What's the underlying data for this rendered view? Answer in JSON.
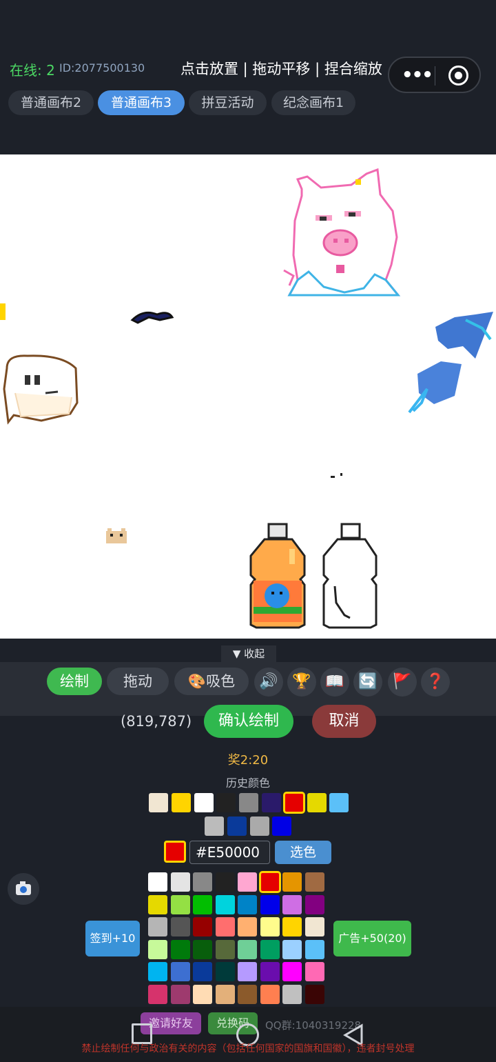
{
  "header": {
    "online": "在线: 2",
    "user_id": "ID:2077500130",
    "hint": "点击放置 | 拖动平移 | 捏合缩放"
  },
  "tabs": [
    {
      "label": "普通画布2",
      "active": false
    },
    {
      "label": "普通画布3",
      "active": true
    },
    {
      "label": "拼豆活动",
      "active": false
    },
    {
      "label": "纪念画布1",
      "active": false
    }
  ],
  "toolbar": {
    "collapse": "▼ 收起",
    "draw": "绘制",
    "drag": "拖动",
    "pick": "吸色",
    "icons": [
      "speaker-icon",
      "trophy-icon",
      "book-icon",
      "refresh-icon",
      "flag-icon",
      "help-icon"
    ]
  },
  "actions": {
    "coord": "(819,787)",
    "confirm": "确认绘制",
    "cancel": "取消"
  },
  "reward": "奖2:20",
  "history": {
    "label": "历史颜色",
    "colors": [
      "#f1e6d2",
      "#ffd400",
      "#ffffff",
      "#222222",
      "#888888",
      "#2a1a6a",
      "#e50000",
      "#e5d900",
      "#5bc0f8",
      "#bbbbbb",
      "#0a3a9a",
      "#aaaaaa",
      "#0000e5"
    ],
    "selected_index": 6
  },
  "current": {
    "color": "#e50000",
    "hex": "#E50000",
    "pick_button": "选色"
  },
  "palette": {
    "colors": [
      "#ffffff",
      "#e4e4e4",
      "#888888",
      "#222222",
      "#ffa7d1",
      "#e50000",
      "#e59500",
      "#a06a42",
      "#e5d900",
      "#94e044",
      "#02be01",
      "#00d3dd",
      "#0083c7",
      "#0000ea",
      "#cf6ee4",
      "#820080",
      "#b5b5b5",
      "#555555",
      "#960000",
      "#ff6e6e",
      "#ffb070",
      "#fffc8c",
      "#ffd400",
      "#f1e6d2",
      "#c7f99a",
      "#007a0b",
      "#085e0c",
      "#57693a",
      "#6fcf97",
      "#009e60",
      "#9bd0ff",
      "#5bc0f8",
      "#00b4f0",
      "#3d6fd1",
      "#0a3a9a",
      "#003a3a",
      "#b59aff",
      "#6a0dad",
      "#ff00ff",
      "#ff69b4",
      "#d6336c",
      "#9e3a6e",
      "#ffdcb4",
      "#e3b07a",
      "#8b5a2b",
      "#ff7f50",
      "#c0c0c0",
      "#3a0505"
    ],
    "selected_index": 5
  },
  "side_buttons": {
    "checkin": "签到+10",
    "ad": "广告+50(20)"
  },
  "footer": {
    "invite": "邀请好友",
    "code": "兑换码",
    "qq": "QQ群:1040319228",
    "warning": "禁止绘制任何与政治有关的内容（包括任何国家的国旗和国徽），违者封号处理"
  }
}
